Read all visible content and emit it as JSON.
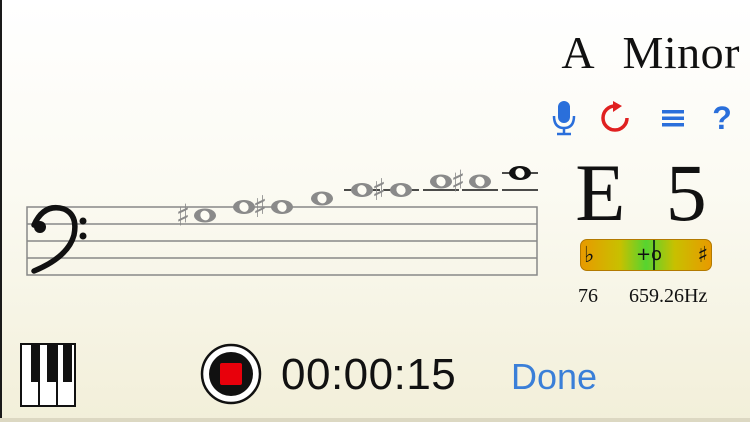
{
  "scale": {
    "key": "A",
    "mode": "Minor",
    "label": "A  Minor"
  },
  "current_note": {
    "name": "E",
    "octave": "5",
    "label": "E  5",
    "midi_number": "76",
    "frequency": "659.26Hz"
  },
  "tuner": {
    "flat_symbol": "♭",
    "sharp_symbol": "♯",
    "offset_label": "+o",
    "cents_offset_fraction": 0.55
  },
  "toolbar": {
    "mic_icon": "microphone-icon",
    "replay_icon": "replay-icon",
    "menu_icon": "menu-icon",
    "help_label": "?"
  },
  "staff": {
    "clef": "bass-clef",
    "notes": [
      {
        "pitch": "G#3",
        "accidental": "♯"
      },
      {
        "pitch": "A3"
      },
      {
        "pitch": "A#3",
        "accidental": "♯"
      },
      {
        "pitch": "B3"
      },
      {
        "pitch": "C4"
      },
      {
        "pitch": "C#4",
        "accidental": "♯"
      },
      {
        "pitch": "D4"
      },
      {
        "pitch": "D#4",
        "accidental": "♯"
      },
      {
        "pitch": "E4",
        "current": true
      }
    ]
  },
  "recorder": {
    "elapsed": "00:00:15",
    "done_label": "Done"
  },
  "colors": {
    "accent_blue": "#2a6fdb",
    "replay_red": "#e02020",
    "record_red": "#e8000b",
    "text": "#111111",
    "ghost_note": "#8a8a8a"
  }
}
